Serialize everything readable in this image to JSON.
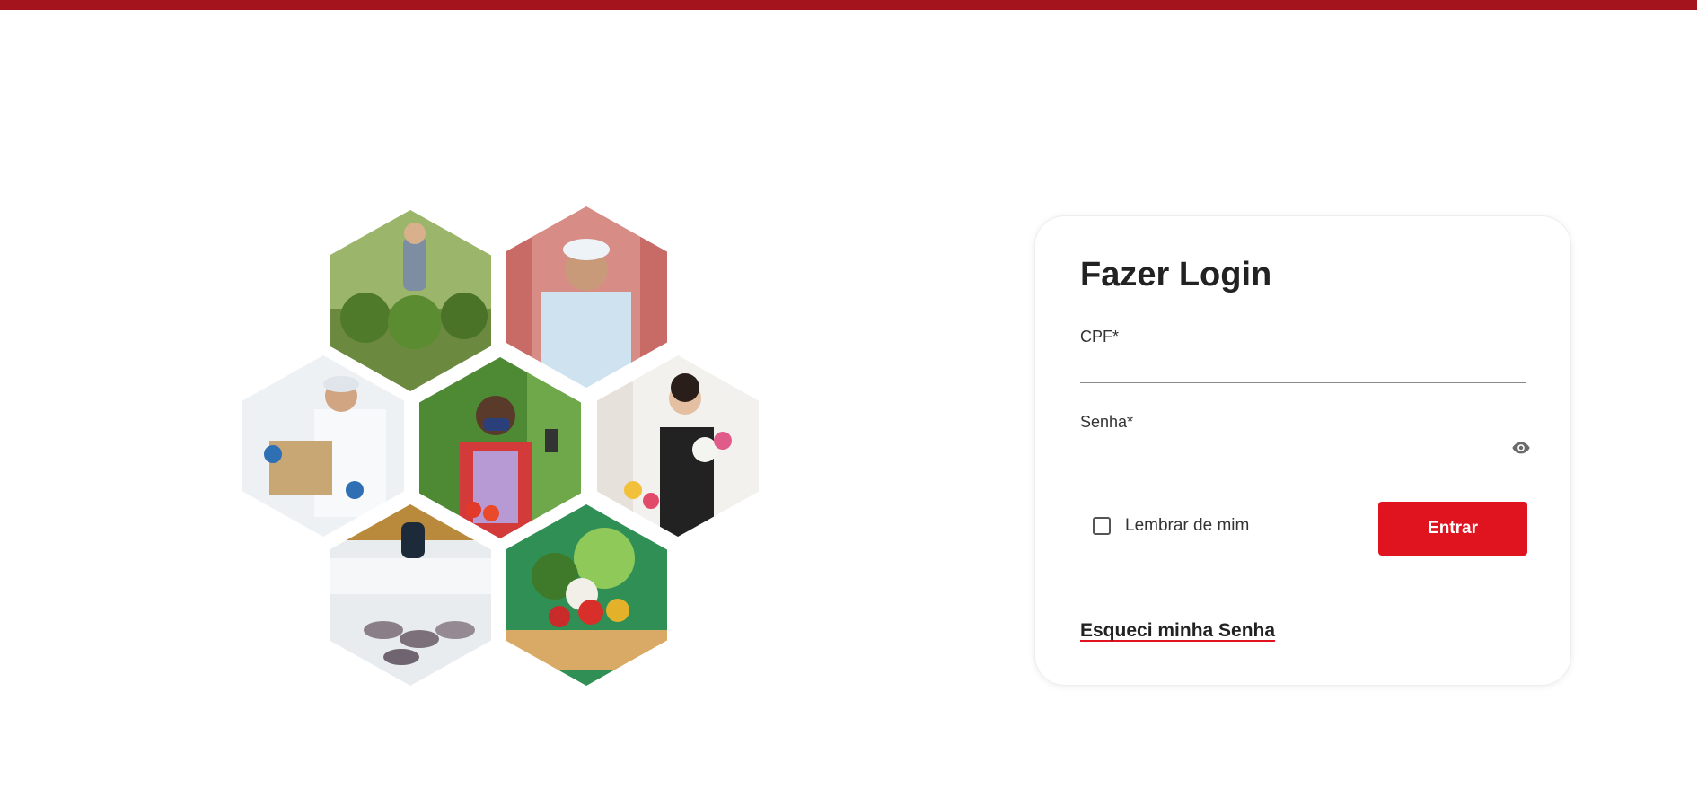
{
  "colors": {
    "topbar": "#a3141c",
    "accent": "#e0141e"
  },
  "hero": {
    "tiles": [
      {
        "name": "hex-photo-plant-nursery"
      },
      {
        "name": "hex-photo-butcher"
      },
      {
        "name": "hex-photo-packer"
      },
      {
        "name": "hex-photo-vegetable-vendor"
      },
      {
        "name": "hex-photo-florist"
      },
      {
        "name": "hex-photo-fish-market"
      },
      {
        "name": "hex-photo-produce-crate"
      }
    ]
  },
  "login": {
    "title": "Fazer Login",
    "cpf_label": "CPF*",
    "cpf_value": "",
    "password_label": "Senha*",
    "password_value": "",
    "password_toggle_icon": "eye-icon",
    "remember_label": "Lembrar de mim",
    "remember_checked": false,
    "submit_label": "Entrar",
    "forgot_label": "Esqueci minha Senha"
  }
}
